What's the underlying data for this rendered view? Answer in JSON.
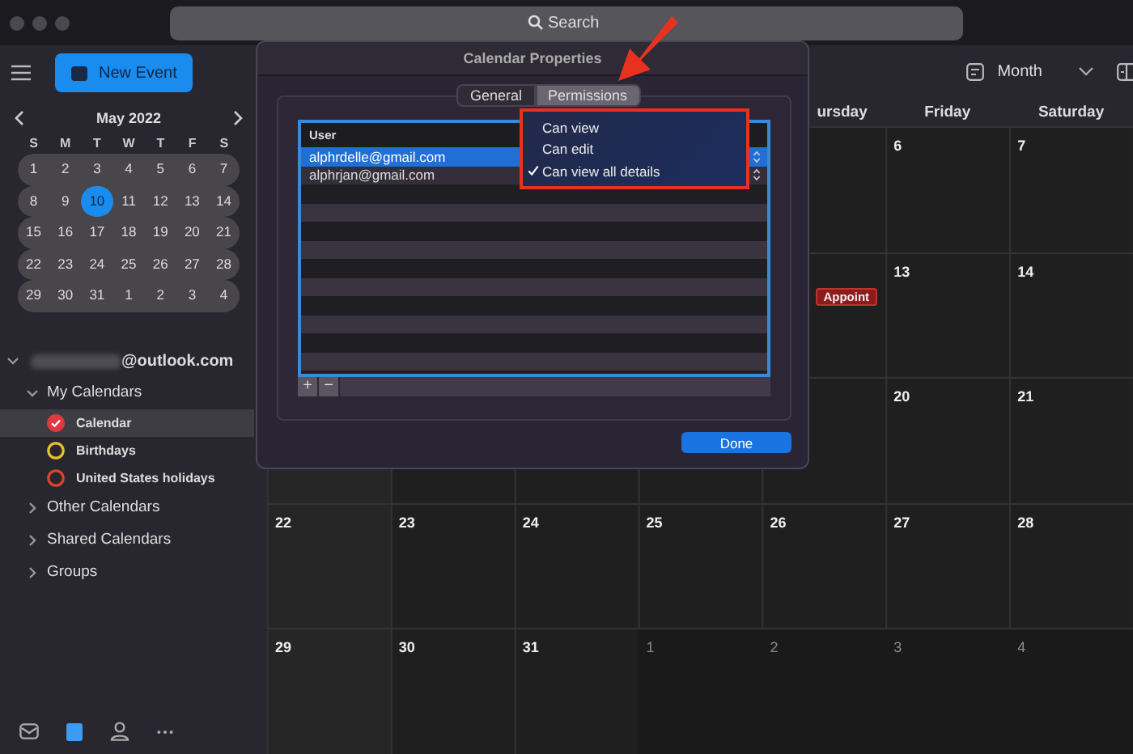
{
  "window": {
    "search": {
      "placeholder": "Search"
    }
  },
  "sidebar": {
    "new_event": "New Event",
    "mini_calendar": {
      "month": "May 2022",
      "weekdays": [
        "S",
        "M",
        "T",
        "W",
        "T",
        "F",
        "S"
      ],
      "weeks": [
        [
          {
            "day": "1",
            "selected": false
          },
          {
            "day": "2",
            "selected": false
          },
          {
            "day": "3",
            "selected": false
          },
          {
            "day": "4",
            "selected": false
          },
          {
            "day": "5",
            "selected": false
          },
          {
            "day": "6",
            "selected": false
          },
          {
            "day": "7",
            "selected": false
          }
        ],
        [
          {
            "day": "8",
            "selected": false
          },
          {
            "day": "9",
            "selected": false
          },
          {
            "day": "10",
            "selected": true
          },
          {
            "day": "11",
            "selected": false
          },
          {
            "day": "12",
            "selected": false
          },
          {
            "day": "13",
            "selected": false
          },
          {
            "day": "14",
            "selected": false
          }
        ],
        [
          {
            "day": "15",
            "selected": false
          },
          {
            "day": "16",
            "selected": false
          },
          {
            "day": "17",
            "selected": false
          },
          {
            "day": "18",
            "selected": false
          },
          {
            "day": "19",
            "selected": false
          },
          {
            "day": "20",
            "selected": false
          },
          {
            "day": "21",
            "selected": false
          }
        ],
        [
          {
            "day": "22",
            "selected": false
          },
          {
            "day": "23",
            "selected": false
          },
          {
            "day": "24",
            "selected": false
          },
          {
            "day": "25",
            "selected": false
          },
          {
            "day": "26",
            "selected": false
          },
          {
            "day": "27",
            "selected": false
          },
          {
            "day": "28",
            "selected": false
          }
        ],
        [
          {
            "day": "29",
            "selected": false
          },
          {
            "day": "30",
            "selected": false
          },
          {
            "day": "31",
            "selected": false
          },
          {
            "day": "1",
            "selected": false
          },
          {
            "day": "2",
            "selected": false
          },
          {
            "day": "3",
            "selected": false
          },
          {
            "day": "4",
            "selected": false
          }
        ]
      ]
    },
    "account": {
      "email": "@outlook.com",
      "expanded": true,
      "groups": [
        {
          "label": "My Calendars",
          "expanded": true,
          "calendars": [
            {
              "name": "Calendar",
              "checked": true,
              "selected": true,
              "color": "#e0383e"
            },
            {
              "name": "Birthdays",
              "checked": false,
              "selected": false,
              "color": "#e8c12a"
            },
            {
              "name": "United States holidays",
              "checked": false,
              "selected": false,
              "color": "#d9452b"
            }
          ]
        },
        {
          "label": "Other Calendars",
          "expanded": false
        },
        {
          "label": "Shared Calendars",
          "expanded": false
        },
        {
          "label": "Groups",
          "expanded": false
        }
      ]
    },
    "nav": [
      {
        "kind": "mail",
        "selected": false
      },
      {
        "kind": "calendar",
        "selected": true
      },
      {
        "kind": "people",
        "selected": false
      },
      {
        "kind": "more",
        "selected": false
      }
    ]
  },
  "toolbar": {
    "view": "Month"
  },
  "calendar": {
    "weekdays": [
      "ursday",
      "Friday",
      "Saturday"
    ],
    "weeks": [
      [
        {
          "day": "6",
          "outside": false
        },
        {
          "day": "7",
          "outside": false
        }
      ],
      [
        {
          "event": "Appoint"
        },
        {
          "day": "13",
          "outside": false
        },
        {
          "day": "14",
          "outside": false
        }
      ],
      [
        {
          "day": "20",
          "outside": false
        },
        {
          "day": "21",
          "outside": false
        }
      ],
      [
        {
          "day": "22",
          "outside": false
        },
        {
          "day": "23",
          "outside": false
        },
        {
          "day": "24",
          "outside": false
        },
        {
          "day": "25",
          "outside": false
        },
        {
          "day": "26",
          "outside": false
        },
        {
          "day": "27",
          "outside": false
        },
        {
          "day": "28",
          "outside": false
        }
      ],
      [
        {
          "day": "29",
          "outside": false
        },
        {
          "day": "30",
          "outside": false
        },
        {
          "day": "31",
          "outside": false
        },
        {
          "day": "1",
          "outside": true
        },
        {
          "day": "2",
          "outside": true
        },
        {
          "day": "3",
          "outside": true
        },
        {
          "day": "4",
          "outside": true
        }
      ]
    ]
  },
  "dialog": {
    "title": "Calendar Properties",
    "tabs": [
      {
        "label": "General",
        "selected": false
      },
      {
        "label": "Permissions",
        "selected": true
      }
    ],
    "table": {
      "columns": [
        "User"
      ],
      "rows": [
        {
          "user": "alphrdelle@gmail.com",
          "selected": true
        },
        {
          "user": "alphrjan@gmail.com",
          "selected": false
        }
      ]
    },
    "add": "+",
    "remove": "−",
    "menu": [
      {
        "label": "Can view",
        "checked": false
      },
      {
        "label": "Can edit",
        "checked": false
      },
      {
        "label": "Can view all details",
        "checked": true
      }
    ],
    "done": "Done"
  }
}
